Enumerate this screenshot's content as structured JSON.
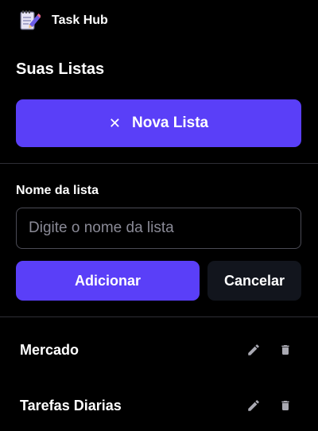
{
  "app": {
    "title": "Task Hub",
    "logo_icon": "notepad-pencil-icon"
  },
  "sidebar": {
    "section_title": "Suas Listas",
    "new_list_button": {
      "icon": "close-icon",
      "icon_glyph": "✕",
      "label": "Nova Lista"
    },
    "form": {
      "label": "Nome da lista",
      "input_value": "",
      "input_placeholder": "Digite o nome da lista",
      "add_label": "Adicionar",
      "cancel_label": "Cancelar"
    },
    "lists": [
      {
        "label": "Mercado",
        "edit_icon": "pencil-icon",
        "delete_icon": "trash-icon"
      },
      {
        "label": "Tarefas Diarias",
        "edit_icon": "pencil-icon",
        "delete_icon": "trash-icon"
      }
    ]
  },
  "colors": {
    "background": "#000000",
    "accent": "#5a3ff8",
    "secondary_button": "#12151d",
    "divider": "#2e2e35",
    "icon_muted": "#a9a9b2"
  }
}
